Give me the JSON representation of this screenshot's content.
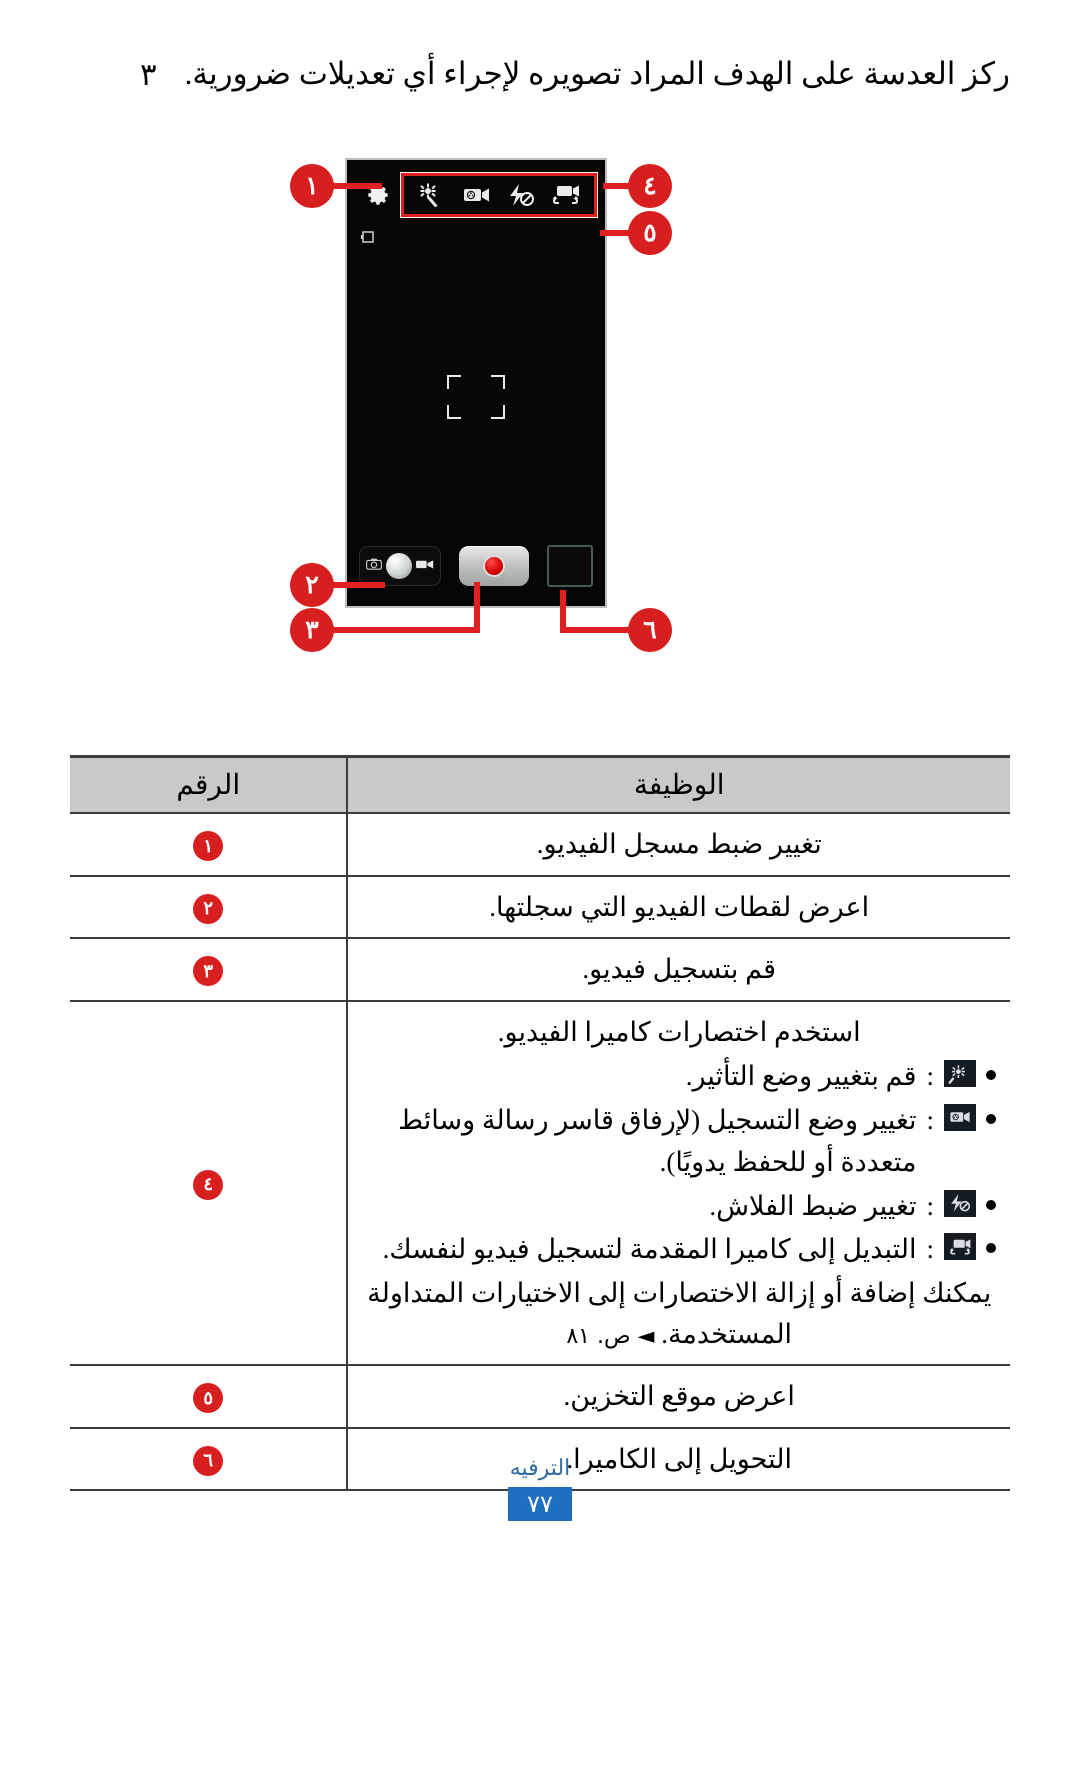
{
  "step": {
    "number": "٣",
    "text": "ركز العدسة على الهدف المراد تصويره لإجراء أي تعديلات ضرورية."
  },
  "illustration": {
    "callouts": [
      "١",
      "٢",
      "٣",
      "٤",
      "٥",
      "٦"
    ],
    "camera_ui": {
      "settings_icon": "gear-icon",
      "shortcut_icons": [
        "effects-wand-icon",
        "recording-mode-camcorder-icon",
        "flash-off-icon",
        "switch-camera-icon"
      ],
      "storage_icon": "storage-location-icon",
      "focus_frame": "focus-brackets",
      "thumbnail": "gallery-thumbnail",
      "record_button": "record-button",
      "mode_toggle": {
        "video_icon": "camcorder-icon",
        "camera_icon": "camera-icon"
      }
    }
  },
  "table": {
    "headers": {
      "function": "الوظيفة",
      "number": "الرقم"
    },
    "rows": [
      {
        "num": "١",
        "text": "تغيير ضبط مسجل الفيديو."
      },
      {
        "num": "٢",
        "text": "اعرض لقطات الفيديو التي سجلتها."
      },
      {
        "num": "٣",
        "text": "قم بتسجيل فيديو."
      },
      {
        "num": "٤",
        "intro": "استخدم اختصارات كاميرا الفيديو.",
        "bullets": [
          {
            "icon": "effects-wand-icon",
            "text": "قم بتغيير وضع التأثير."
          },
          {
            "icon": "recording-mode-camcorder-icon",
            "text": "تغيير وضع التسجيل (لإرفاق قاسر رسالة وسائط متعددة أو للحفظ يدويًا)."
          },
          {
            "icon": "flash-off-icon",
            "text": "تغيير ضبط الفلاش."
          },
          {
            "icon": "switch-camera-icon",
            "text": "التبديل إلى كاميرا المقدمة لتسجيل فيديو لنفسك."
          }
        ],
        "tail": "يمكنك إضافة أو إزالة الاختصارات إلى الاختيارات المتداولة المستخدمة.",
        "tail_ref": "◄ ص. ٨١"
      },
      {
        "num": "٥",
        "text": "اعرض موقع التخزين."
      },
      {
        "num": "٦",
        "text": "التحويل إلى الكاميرا."
      }
    ]
  },
  "footer": {
    "section": "الترفيه",
    "page": "٧٧"
  },
  "colors": {
    "callout_red": "#d81f1f",
    "lead_red": "#e02020",
    "header_gray": "#c9c9c9",
    "footer_blue": "#1f6fc0",
    "footer_label_blue": "#2e6ca4"
  }
}
